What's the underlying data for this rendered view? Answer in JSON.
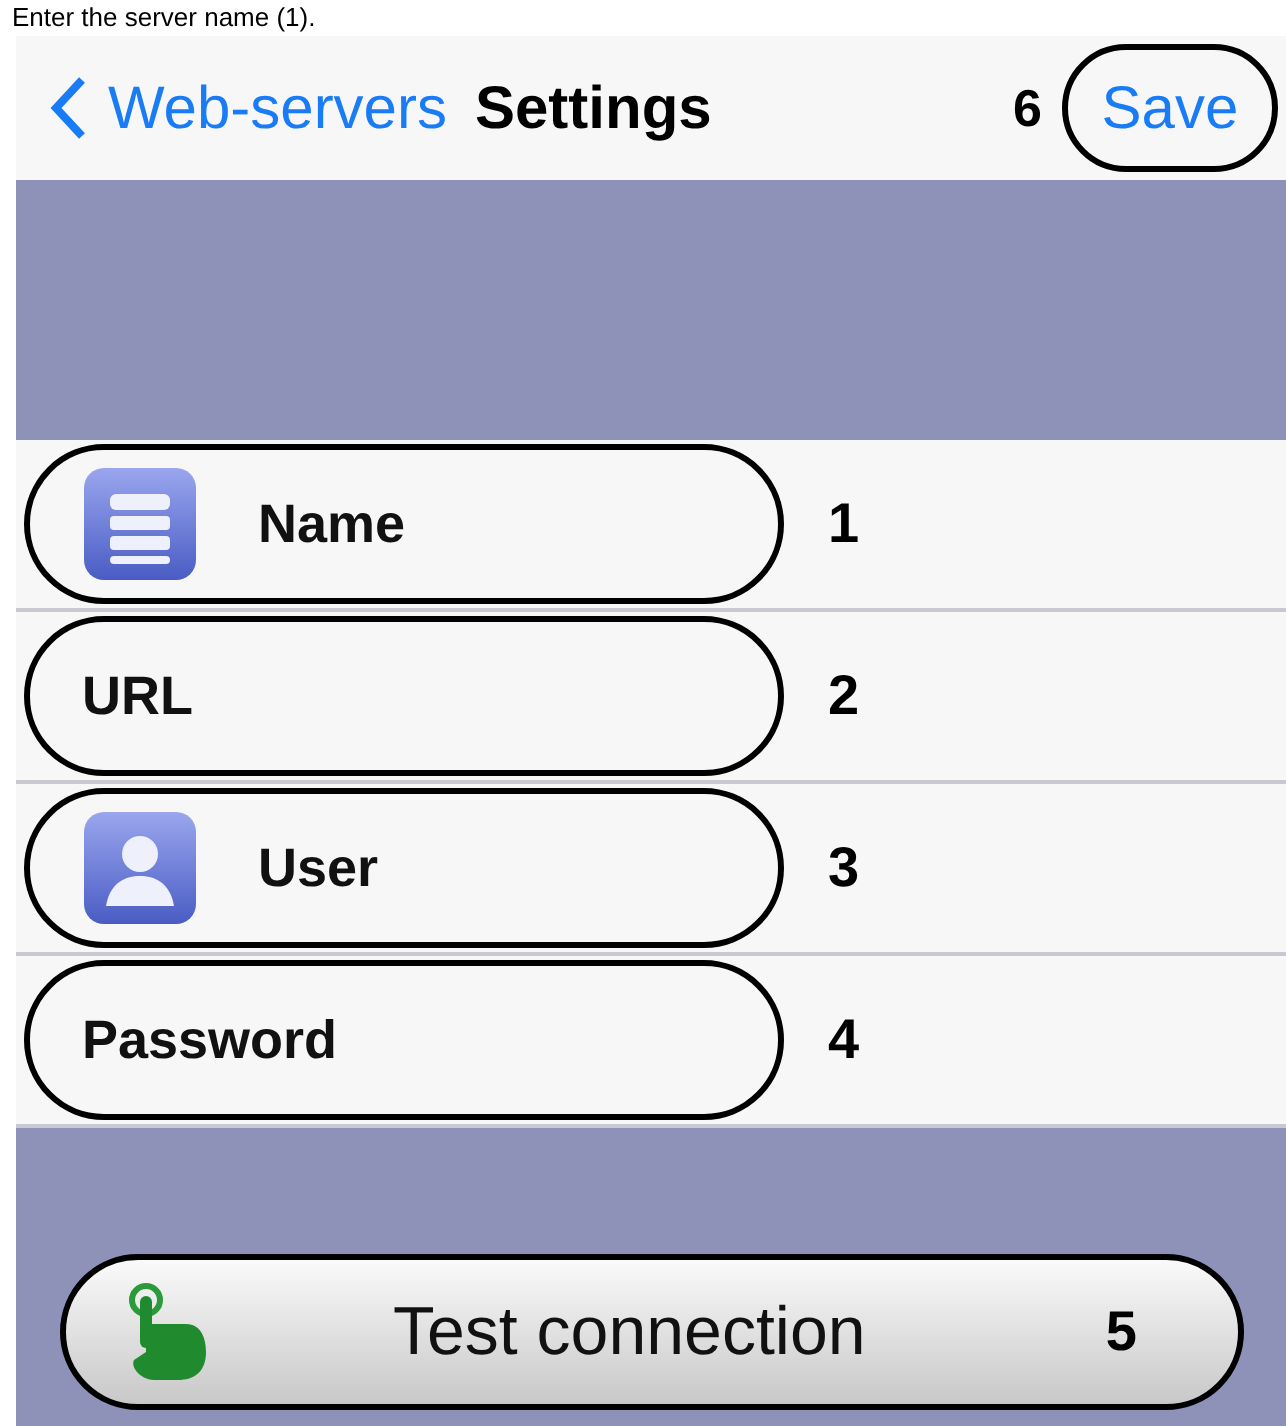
{
  "caption": "Enter the server name (1).",
  "nav": {
    "back_label": "Web-servers",
    "title": "Settings",
    "save_label": "Save",
    "save_callout": "6"
  },
  "fields": [
    {
      "kind": "server",
      "label": "Name",
      "callout": "1"
    },
    {
      "kind": "plain",
      "label": "URL",
      "callout": "2"
    },
    {
      "kind": "user",
      "label": "User",
      "callout": "3"
    },
    {
      "kind": "plain",
      "label": "Password",
      "callout": "4"
    }
  ],
  "test_button": {
    "label": "Test connection",
    "callout": "5"
  }
}
